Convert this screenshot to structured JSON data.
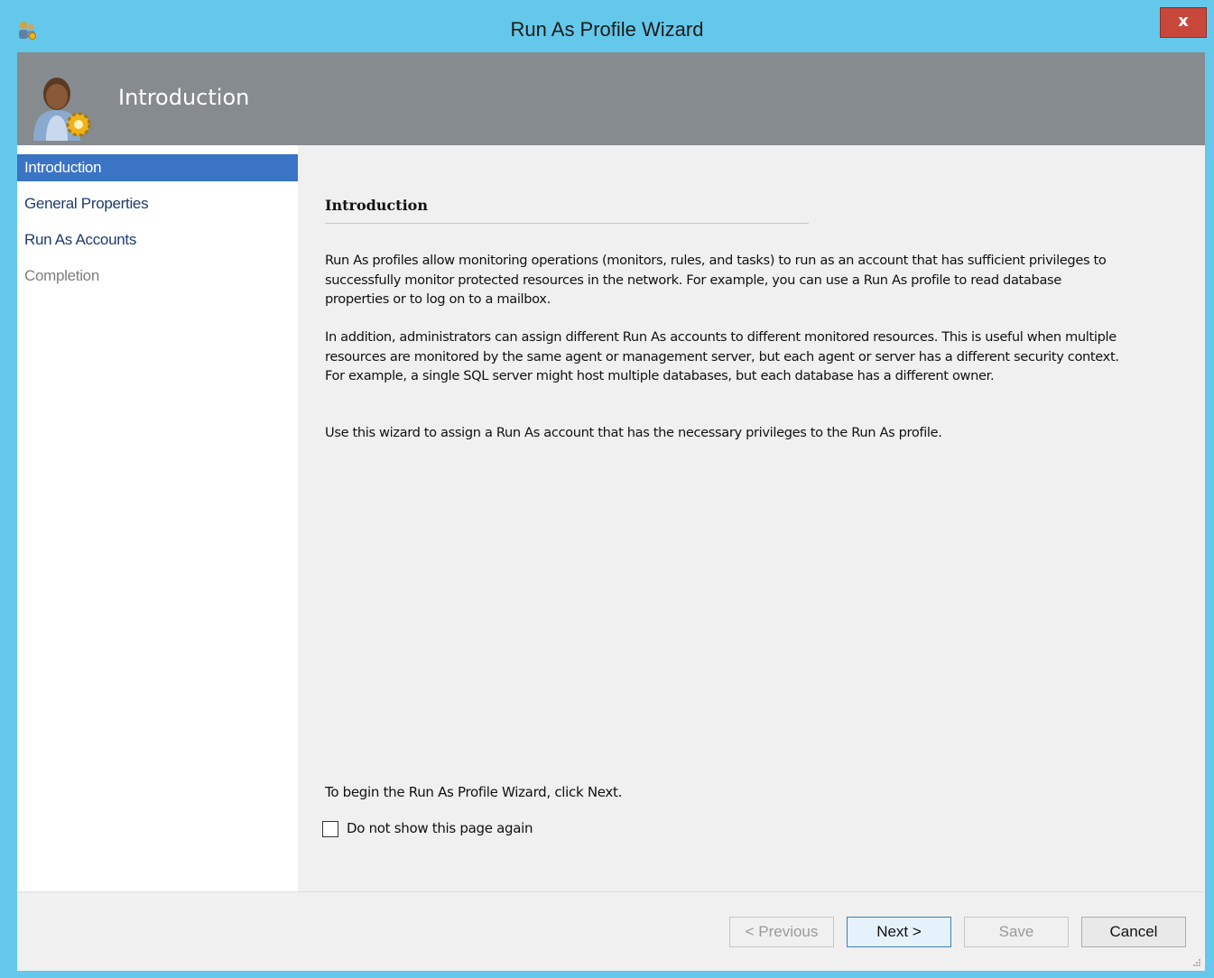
{
  "window": {
    "title": "Run As Profile Wizard",
    "close_label": "x"
  },
  "header": {
    "title": "Introduction"
  },
  "sidebar": {
    "items": [
      {
        "label": "Introduction",
        "state": "selected"
      },
      {
        "label": "General Properties",
        "state": "normal"
      },
      {
        "label": "Run As Accounts",
        "state": "normal"
      },
      {
        "label": "Completion",
        "state": "disabled"
      }
    ]
  },
  "content": {
    "section_title": "Introduction",
    "paragraphs": [
      "Run As profiles allow monitoring operations (monitors, rules, and tasks) to run as an account that has sufficient privileges to successfully monitor protected resources in the network. For example, you can use a Run As profile to read database properties or to log on to a mailbox.",
      "In addition, administrators can assign different Run As accounts to different monitored resources. This is useful when multiple resources are monitored by the same agent or management server, but each agent or server has a different security context. For example, a single SQL server might host multiple databases, but each database has a different owner.",
      "Use this wizard to assign a Run As account that has the necessary privileges to the Run As profile."
    ],
    "begin_text": "To begin the Run As Profile Wizard, click Next.",
    "checkbox": {
      "label": "Do not show this page again",
      "checked": false
    }
  },
  "footer": {
    "previous_label": "< Previous",
    "next_label": "Next >",
    "save_label": "Save",
    "cancel_label": "Cancel"
  },
  "colors": {
    "titlebar": "#64c8ea",
    "header_band": "#858b8f",
    "nav_selected": "#3b74c4",
    "close_button": "#c8473b"
  },
  "icons": {
    "app": "users-gear-icon",
    "header": "user-gear-avatar-icon",
    "close": "close-icon"
  }
}
